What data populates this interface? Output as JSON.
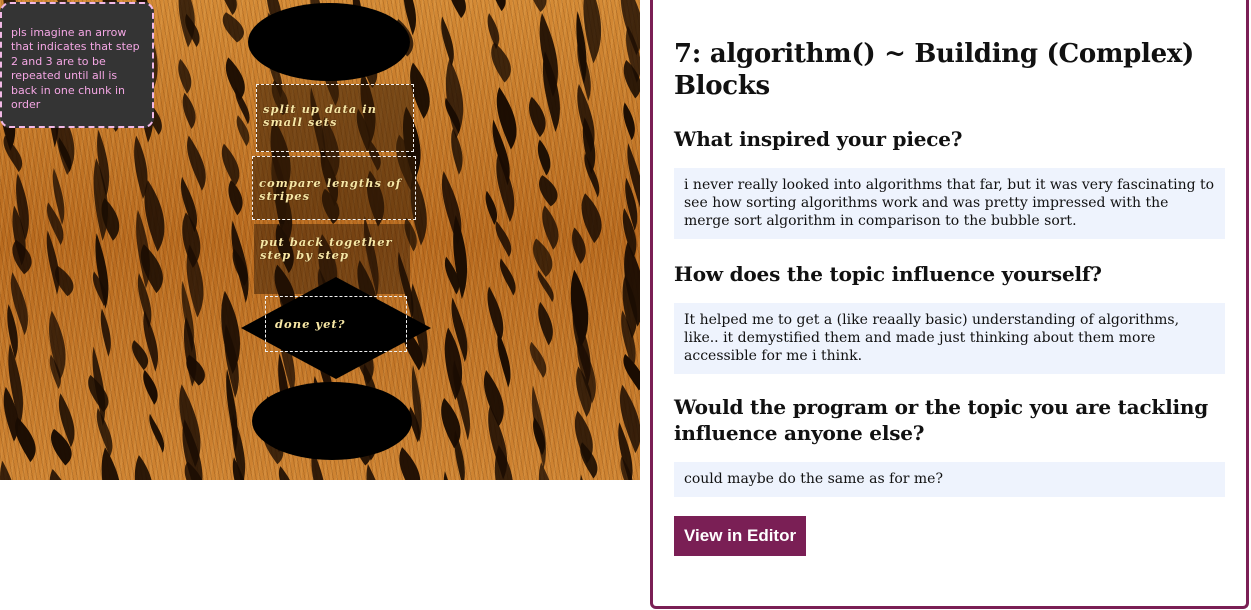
{
  "sketch": {
    "note_text": "pls imagine an arrow that indicates that step 2 and 3 are to be repeated until all is back in one chunk in order",
    "steps": [
      "split up data in small sets",
      "compare lengths of stripes",
      "put back together step by step"
    ],
    "decision": "done yet?",
    "colors": {
      "fur_orange": "#c57a2a",
      "stripe_dark": "#1a0c02",
      "step_text": "#f7e7a5",
      "note_text": "#f4a6e4",
      "note_bg": "#343434"
    }
  },
  "panel": {
    "title": "7: algorithm() ~ Building (Complex) Blocks",
    "questions": [
      {
        "question": "What inspired your piece?",
        "answer": "i never really looked into algorithms that far, but it was very fascinating to see how sorting algorithms work and was pretty impressed with the merge sort algorithm in comparison to the bubble sort."
      },
      {
        "question": "How does the topic influence yourself?",
        "answer": "It helped me to get a (like reaally basic) understanding of algorithms, like.. it demystified them and made just thinking about them more accessible for me i think."
      },
      {
        "question": "Would the program or the topic you are tackling influence anyone else?",
        "answer": "could maybe do the same as for me?"
      }
    ],
    "editor_button": "View in Editor",
    "accent_color": "#7a1f55",
    "answer_bg": "#eef3fd"
  }
}
